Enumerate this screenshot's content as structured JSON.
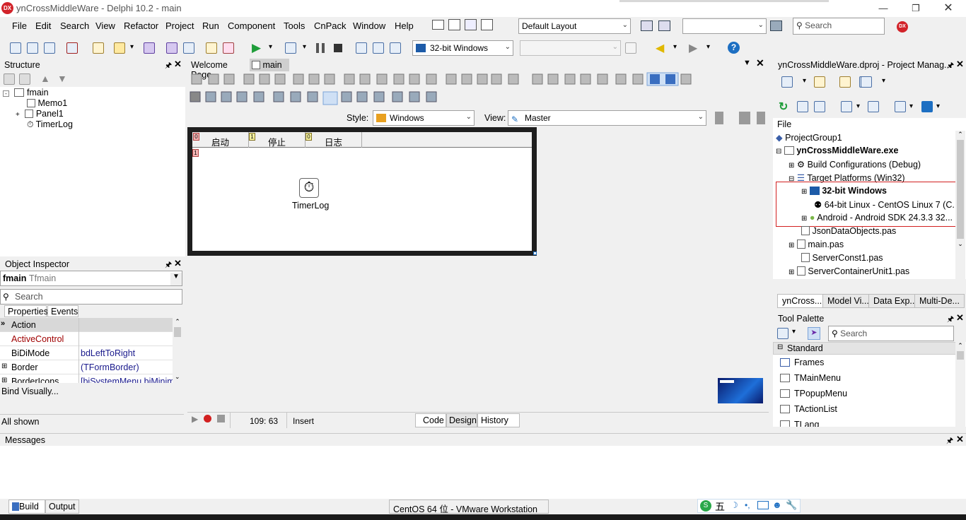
{
  "window": {
    "title": "ynCrossMiddleWare - Delphi 10.2 - main",
    "logo": "DX",
    "controls": [
      "minimize-icon",
      "restore-icon",
      "close-icon"
    ]
  },
  "menu": [
    "File",
    "Edit",
    "Search",
    "View",
    "Refactor",
    "Project",
    "Run",
    "Component",
    "Tools",
    "CnPack",
    "Window",
    "Help"
  ],
  "toolbar": {
    "layout_combo": "Default Layout",
    "platform_combo": "32-bit Windows",
    "search_placeholder": "Search",
    "empty_combo_1": "",
    "empty_combo_2": ""
  },
  "structure": {
    "title": "Structure",
    "items": [
      {
        "label": "fmain"
      },
      {
        "label": "Memo1"
      },
      {
        "label": "Panel1"
      },
      {
        "label": "TimerLog"
      }
    ]
  },
  "object_inspector": {
    "title": "Object Inspector",
    "object_name": "fmain",
    "object_type": "Tfmain",
    "search_placeholder": "Search",
    "tabs": [
      "Properties",
      "Events"
    ],
    "rows": [
      {
        "name": "Action",
        "value": "",
        "name_color": "#000000"
      },
      {
        "name": "ActiveControl",
        "value": "",
        "name_color": "#a00000"
      },
      {
        "name": "BiDiMode",
        "value": "bdLeftToRight",
        "name_color": "#000000"
      },
      {
        "name": "Border",
        "value": "(TFormBorder)",
        "name_color": "#000000"
      },
      {
        "name": "BorderIcons",
        "value": "[biSystemMenu,biMinimi",
        "name_color": "#000000"
      }
    ],
    "bind_visually": "Bind Visually...",
    "all_shown": "All shown"
  },
  "editor": {
    "tabs": [
      "Welcome Page",
      "main"
    ],
    "style_label": "Style:",
    "style_value": "Windows",
    "view_label": "View:",
    "view_value": "Master",
    "form_tabs": [
      "启动",
      "停止",
      "日志"
    ],
    "form_tab_badges": [
      "0",
      "1",
      "0"
    ],
    "component_label": "TimerLog",
    "status_pos": "109: 63",
    "status_mode": "Insert",
    "bottom_tabs": [
      "Code",
      "Design",
      "History"
    ]
  },
  "project_manager": {
    "title": "ynCrossMiddleWare.dproj - Project Manag...",
    "file_label": "File",
    "items": [
      {
        "label": "ProjectGroup1",
        "bold": false
      },
      {
        "label": "ynCrossMiddleWare.exe",
        "bold": true
      },
      {
        "label": "Build Configurations (Debug)",
        "bold": false
      },
      {
        "label": "Target Platforms (Win32)",
        "bold": false
      },
      {
        "label": "32-bit Windows",
        "bold": true
      },
      {
        "label": "64-bit Linux - CentOS Linux 7 (C...",
        "bold": false
      },
      {
        "label": "Android - Android SDK 24.3.3 32...",
        "bold": false
      },
      {
        "label": "JsonDataObjects.pas",
        "bold": false
      },
      {
        "label": "main.pas",
        "bold": false
      },
      {
        "label": "ServerConst1.pas",
        "bold": false
      },
      {
        "label": "ServerContainerUnit1.pas",
        "bold": false
      }
    ],
    "bottom_tabs": [
      "ynCross...",
      "Model Vi...",
      "Data Exp...",
      "Multi-De..."
    ]
  },
  "tool_palette": {
    "title": "Tool Palette",
    "search_placeholder": "Search",
    "category": "Standard",
    "items": [
      "Frames",
      "TMainMenu",
      "TPopupMenu",
      "TActionList",
      "TLang"
    ]
  },
  "messages": {
    "title": "Messages",
    "tabs": [
      "Build",
      "Output"
    ]
  },
  "taskbar": {
    "vmware_label": "CentOS 64 位 - VMware Workstation",
    "ime_label": "五"
  },
  "colors": {
    "highlight_red": "#d22020",
    "accent_blue": "#1d6fc2"
  }
}
